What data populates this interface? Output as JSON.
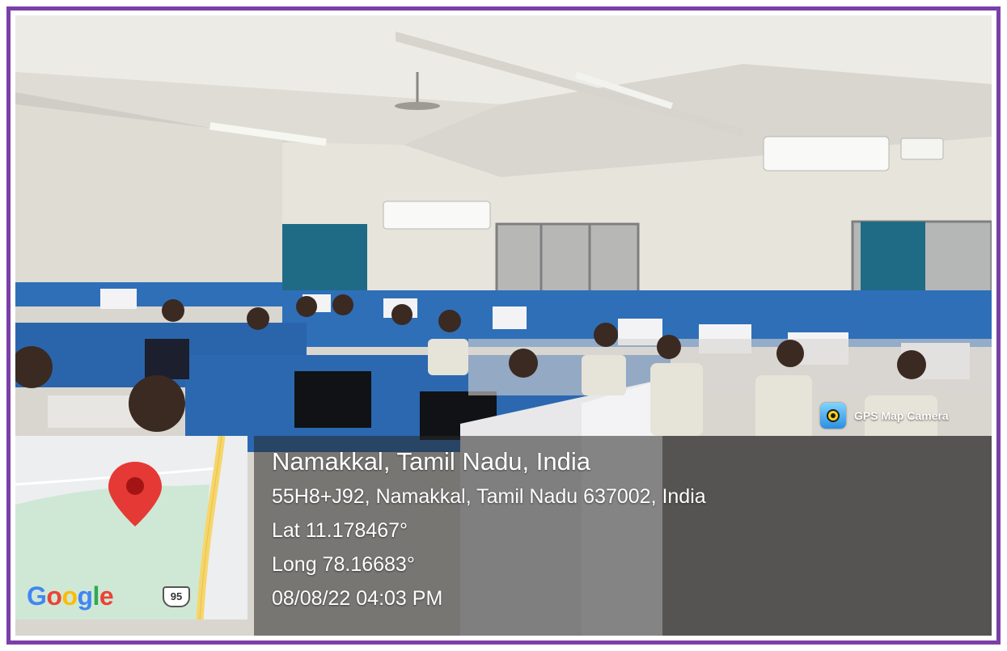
{
  "badge": {
    "label": "GPS Map Camera",
    "icon": "gps-map-camera-icon"
  },
  "map": {
    "logo_text": "Google",
    "route_number": "95",
    "pin_icon": "location-pin-icon",
    "colors": {
      "pin": "#e53935",
      "road": "#f6d66a",
      "land": "#cfe8d5"
    }
  },
  "location": {
    "place": "Namakkal, Tamil Nadu, India",
    "address": "55H8+J92, Namakkal, Tamil Nadu 637002, India",
    "latitude": "Lat 11.178467°",
    "longitude": "Long 78.16683°",
    "datetime": "08/08/22 04:03 PM"
  },
  "colors": {
    "frame": "#7b3fa8",
    "cubicle": "#2f6fb8"
  }
}
